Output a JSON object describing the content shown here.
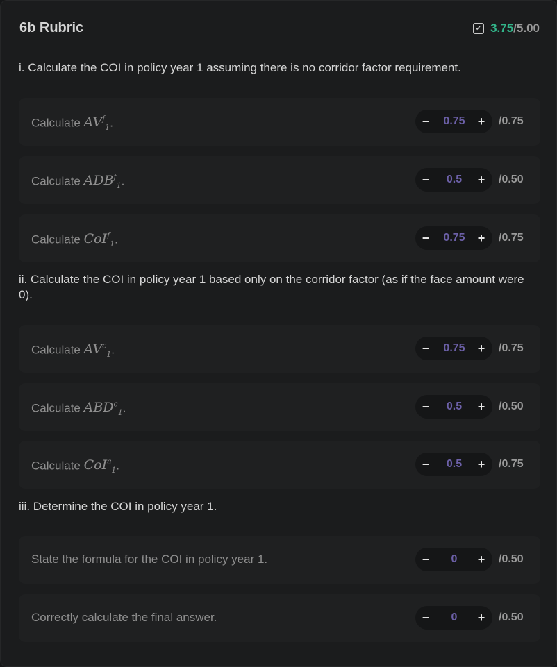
{
  "header": {
    "title": "6b Rubric",
    "score_earned": "3.75",
    "score_sep": "/",
    "score_total": "5.00",
    "icon": "checkbox-icon"
  },
  "sections": [
    {
      "question": "i. Calculate the COI in policy year 1 assuming there is no corridor factor requirement.",
      "items": [
        {
          "label": "Calculate ",
          "math_base": "AV",
          "math_sub": "1",
          "math_sup": "f",
          "suffix": ".",
          "value": "0.75",
          "max": "/0.75"
        },
        {
          "label": "Calculate ",
          "math_base": "ADB",
          "math_sub": "1",
          "math_sup": "f",
          "suffix": ".",
          "value": "0.5",
          "max": "/0.50"
        },
        {
          "label": "Calculate ",
          "math_base": "CoI",
          "math_sub": "1",
          "math_sup": "f",
          "suffix": ".",
          "value": "0.75",
          "max": "/0.75"
        }
      ]
    },
    {
      "question": "ii. Calculate the COI in policy year 1 based only on the corridor factor (as if the face amount were 0).",
      "items": [
        {
          "label": "Calculate ",
          "math_base": "AV",
          "math_sub": "1",
          "math_sup": "c",
          "suffix": ".",
          "value": "0.75",
          "max": "/0.75"
        },
        {
          "label": "Calculate ",
          "math_base": "ABD",
          "math_sub": "1",
          "math_sup": "c",
          "suffix": ".",
          "value": "0.5",
          "max": "/0.50"
        },
        {
          "label": "Calculate ",
          "math_base": "CoI",
          "math_sub": "1",
          "math_sup": "c",
          "suffix": ".",
          "value": "0.5",
          "max": "/0.75"
        }
      ]
    },
    {
      "question": "iii. Determine the COI in policy year 1.",
      "items": [
        {
          "label": "State the formula for the COI in policy year 1.",
          "value": "0",
          "max": "/0.50"
        },
        {
          "label": "Correctly calculate the final answer.",
          "value": "0",
          "max": "/0.50"
        }
      ]
    }
  ],
  "stepper": {
    "minus": "−",
    "plus": "+"
  },
  "colors": {
    "accent_green": "#32b58a",
    "value_purple": "#6c60a8",
    "background": "#1b1c1d"
  }
}
